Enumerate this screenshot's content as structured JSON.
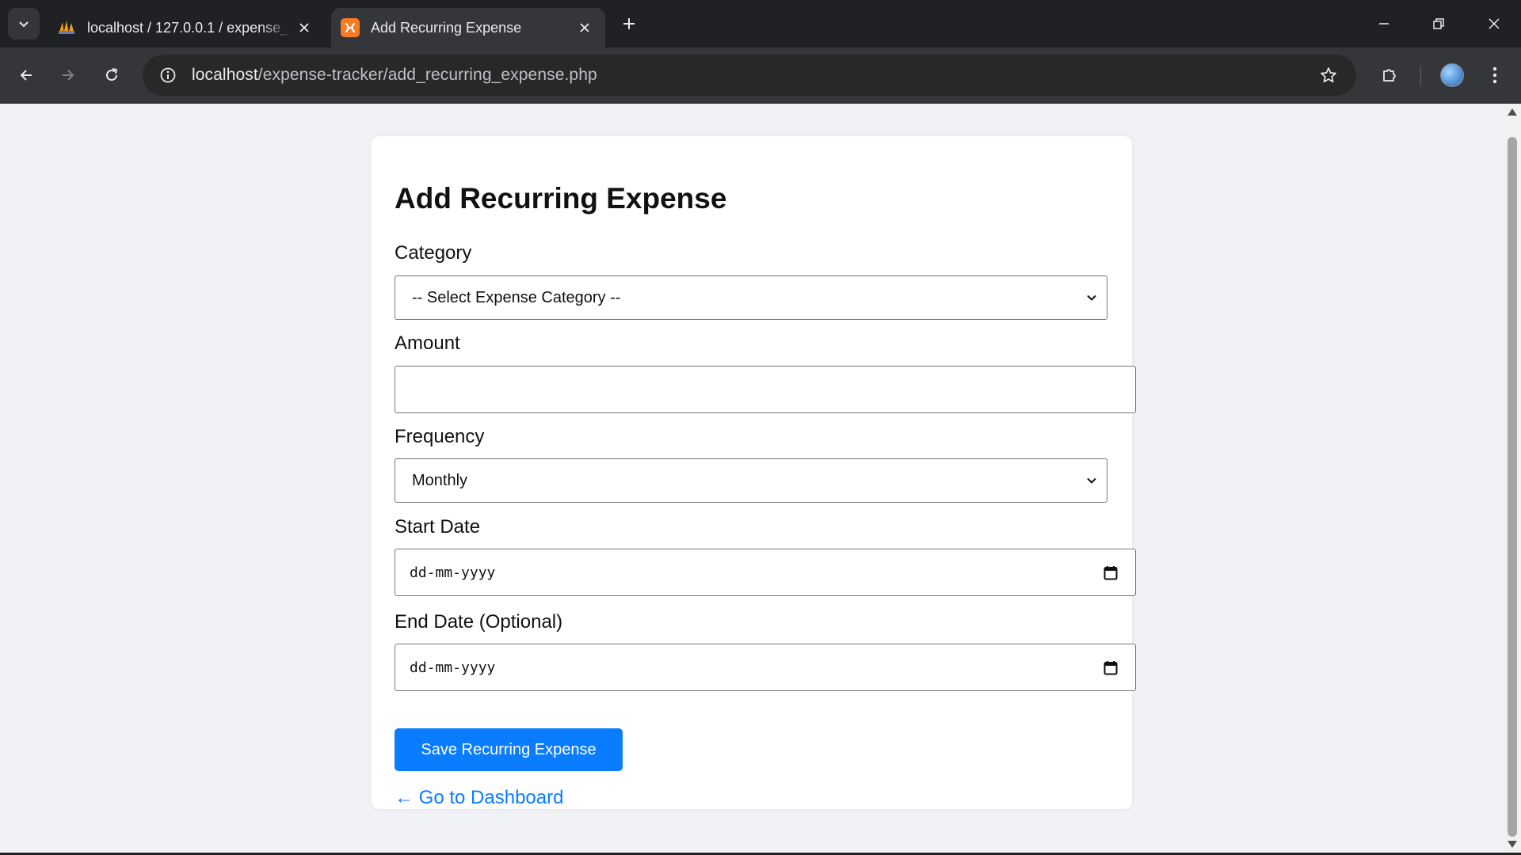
{
  "browser": {
    "tabs": [
      {
        "title": "localhost / 127.0.0.1 / expense_",
        "favicon": "phpmyadmin-icon",
        "active": false
      },
      {
        "title": "Add Recurring Expense",
        "favicon": "xampp-icon",
        "active": true
      }
    ],
    "url_host": "localhost",
    "url_path": "/expense-tracker/add_recurring_expense.php"
  },
  "page": {
    "heading": "Add Recurring Expense",
    "fields": {
      "category": {
        "label": "Category",
        "value": "-- Select Expense Category --"
      },
      "amount": {
        "label": "Amount",
        "value": ""
      },
      "frequency": {
        "label": "Frequency",
        "value": "Monthly"
      },
      "start_date": {
        "label": "Start Date",
        "placeholder": "dd-mm-yyyy"
      },
      "end_date": {
        "label": "End Date (Optional)",
        "placeholder": "dd-mm-yyyy"
      }
    },
    "save_button": "Save Recurring Expense",
    "dashboard_link": "← Go to Dashboard"
  },
  "colors": {
    "page_bg": "#f0f2f5",
    "accent": "#0a7cff",
    "chrome_dark": "#202124",
    "chrome_toolbar": "#35363a"
  }
}
